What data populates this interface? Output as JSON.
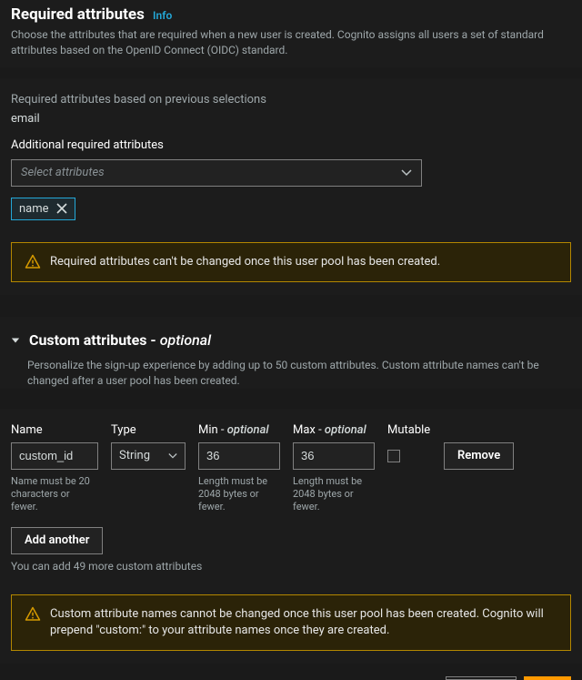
{
  "required": {
    "title": "Required attributes",
    "info": "Info",
    "description": "Choose the attributes that are required when a new user is created. Cognito assigns all users a set of standard attributes based on the OpenID Connect (OIDC) standard.",
    "previous_label": "Required attributes based on previous selections",
    "previous_value": "email",
    "additional_label": "Additional required attributes",
    "select_placeholder": "Select attributes",
    "chips": [
      "name"
    ],
    "warning": "Required attributes can't be changed once this user pool has been created."
  },
  "custom": {
    "title_prefix": "Custom attributes - ",
    "title_suffix": "optional",
    "description": "Personalize the sign-up experience by adding up to 50 custom attributes. Custom attribute names can't be changed after a user pool has been created.",
    "columns": {
      "name": "Name",
      "type": "Type",
      "min_prefix": "Min - ",
      "max_prefix": "Max - ",
      "optional": "optional",
      "mutable": "Mutable"
    },
    "row": {
      "name": "custom_id",
      "type": "String",
      "min": "36",
      "max": "36",
      "mutable": false
    },
    "hints": {
      "name": "Name must be 20 characters or fewer.",
      "min": "Length must be 2048 bytes or fewer.",
      "max": "Length must be 2048 bytes or fewer."
    },
    "remove_label": "Remove",
    "add_another": "Add another",
    "remaining": "You can add 49 more custom attributes",
    "warning": "Custom attribute names cannot be changed once this user pool has been created. Cognito will prepend \"custom:\" to your attribute names once they are created."
  },
  "colors": {
    "accent": "#24a8d8",
    "warn_border": "#b38700",
    "primary": "#ff9900"
  }
}
